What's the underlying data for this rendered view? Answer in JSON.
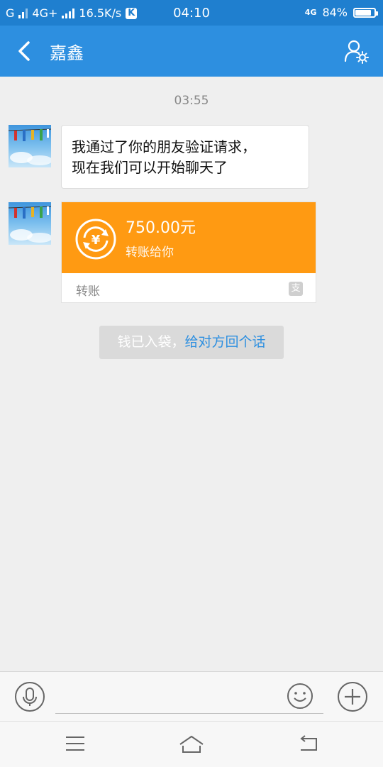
{
  "status_bar": {
    "carrier_left": "G",
    "network": "4G+",
    "speed": "16.5K/s",
    "app_badge": "K",
    "time": "04:10",
    "network_right": "4G",
    "battery_percent": "84%",
    "battery_level": 0.84
  },
  "nav": {
    "title": "嘉鑫"
  },
  "chat": {
    "timestamp": "03:55",
    "messages": [
      {
        "type": "text",
        "lines": [
          "我通过了你的朋友验证请求，",
          "现在我们可以开始聊天了"
        ]
      },
      {
        "type": "transfer",
        "amount": "750.00元",
        "description": "转账给你",
        "label": "转账",
        "badge": "支"
      }
    ],
    "system_tip": {
      "text": "钱已入袋，",
      "link": "给对方回个话"
    }
  },
  "colors": {
    "status_bar": "#1f7fcf",
    "nav_bar": "#2d8fe0",
    "transfer_orange": "#ff9a12",
    "link_blue": "#2d8fe0"
  }
}
